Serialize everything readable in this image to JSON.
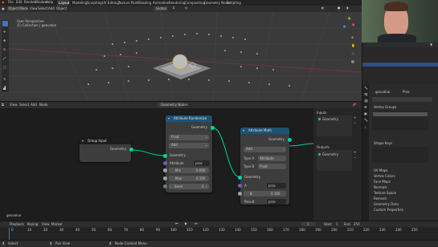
{
  "topbar": {
    "menus": [
      "File",
      "Edit",
      "Render",
      "Window",
      "Help"
    ],
    "workspaces": [
      "Layout",
      "Modeling",
      "Sculpting",
      "UV Editing",
      "Texture Paint",
      "Shading",
      "Animation",
      "Rendering",
      "Compositing",
      "Geometry Nodes",
      "Scripting"
    ]
  },
  "viewport": {
    "mode": "Object Mode",
    "menus": [
      "View",
      "Select",
      "Add",
      "Object"
    ],
    "transform": "Global",
    "info_line1": "User Perspective",
    "info_line2": "(1) Collection | geovalue"
  },
  "node_editor": {
    "menus": [
      "View",
      "Select",
      "Add",
      "Node"
    ],
    "tree_name": "Geometry Nodes",
    "object_label": "geovalue",
    "group_input": {
      "title": "Group Input",
      "out": "Geometry"
    },
    "randomize": {
      "title": "Attribute Randomize",
      "out": "Geometry",
      "type": "Float",
      "op": "Add",
      "in_geometry": "Geometry",
      "attribute_label": "Attribute",
      "attribute_value": "prox",
      "min_label": "Min",
      "min_value": "0.000",
      "max_label": "Max",
      "max_value": "0.100",
      "seed_label": "Seed",
      "seed_value": "2"
    },
    "math": {
      "title": "Attribute Math",
      "out": "Geometry",
      "op": "Add",
      "type_a_label": "Type A",
      "type_a_value": "Attribute",
      "type_b_label": "Type B",
      "type_b_value": "Float",
      "in_geometry": "Geometry",
      "a_label": "A",
      "a_value": "prox",
      "b_label": "B",
      "b_value": "0.100",
      "result_label": "Result",
      "result_value": "prox"
    },
    "side_inputs": {
      "title": "Inputs",
      "item": "Geometry"
    },
    "side_outputs": {
      "title": "Outputs",
      "item": "Geometry"
    }
  },
  "outliner": {
    "object": "geovalue"
  },
  "properties": {
    "object_name": "geovalue",
    "object_tab": "Prox",
    "sections": [
      "Vertex Groups",
      "Shape Keys",
      "UV Maps",
      "Vertex Colors",
      "Face Maps",
      "Normals",
      "Texture Space",
      "Remesh",
      "Geometry Data",
      "Custom Properties"
    ]
  },
  "timeline": {
    "menus": [
      "Playback",
      "Keying",
      "View",
      "Marker"
    ],
    "current_frame": "1",
    "start_label": "Start",
    "start": "1",
    "end_label": "End",
    "end": "250",
    "ticks": [
      "0",
      "10",
      "20",
      "30",
      "40",
      "50",
      "60",
      "70",
      "80",
      "90",
      "100",
      "110",
      "120",
      "130",
      "140",
      "150",
      "160",
      "170",
      "180",
      "190",
      "200",
      "210",
      "220",
      "230",
      "240",
      "250"
    ]
  },
  "statusbar": {
    "left": "Select",
    "middle": "Pan View",
    "right": "Node Context Menu"
  },
  "colors": {
    "geometry_socket": "#00d4a3",
    "float_socket": "#a1a1a1",
    "string_socket": "#6363c7",
    "node_header_attr": "#1e5374",
    "group_header": "#1d1d1d",
    "wire": "#00d4a3"
  }
}
